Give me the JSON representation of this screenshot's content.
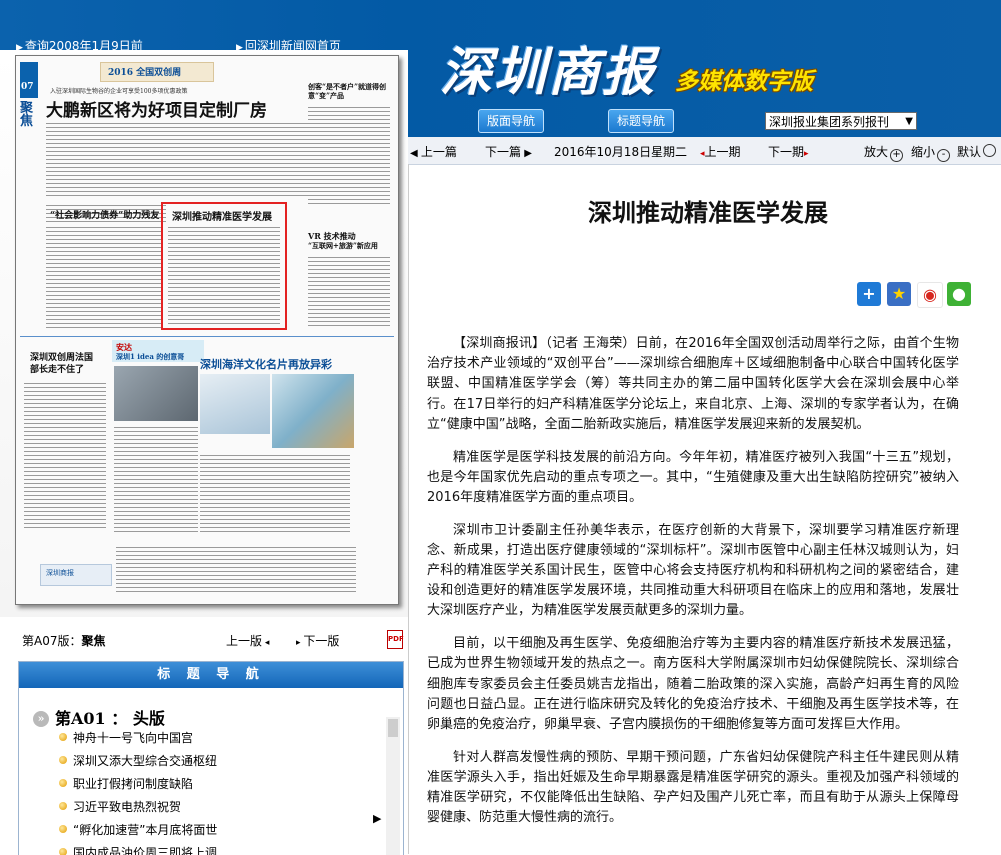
{
  "header": {
    "history_link": "查询2008年1月9日前",
    "home_link": "回深圳新闻网首页",
    "logo_text": "深圳商报",
    "logo_subtitle": "多媒体数字版",
    "nav_buttons": [
      "版面导航",
      "标题导航"
    ],
    "series_select": "深圳报业集团系列报刊"
  },
  "newspaper_page": {
    "page_number": "07",
    "section": "聚焦",
    "banner": "2016 全国双创周",
    "kicker": "入驻深圳国际生物谷的企业可享受100多项优惠政策",
    "main_headline": "大鹏新区将为好项目定制厂房",
    "side_headline": "“社会影响力债券”助力残友",
    "highlighted_headline": "深圳推动精准医学发展",
    "top_right_headline": "创客“是不者户”就道得创意“变”产品",
    "mid_right_headline_1": "VR 技术推动",
    "mid_right_headline_2": "“互联网+旅游”新应用",
    "bottom_left_headline": "深圳双创周法国部长走不住了",
    "bottom_mid_badge": "安达",
    "bottom_mid_headline": "深圳1 idea 的创意哥",
    "bottom_right_headline": "深圳海洋文化名片再放异彩",
    "footer_tag": "深圳商报"
  },
  "page_info": {
    "label": "第A07版：",
    "name": "聚焦",
    "prev_page": "上一版",
    "next_page": "下一版",
    "pdf_icon": "pdf-icon"
  },
  "title_nav": {
    "header": "标 题 导 航",
    "section": "第A01 ： 头版",
    "items": [
      "神舟十一号飞向中国宫",
      "深圳又添大型综合交通枢纽",
      "职业打假拷问制度缺陷",
      "习近平致电热烈祝贺",
      "“孵化加速营”本月底将面世",
      "国内成品油价周三即将上调"
    ]
  },
  "toolbar": {
    "prev_article": "上一篇",
    "next_article": "下一篇",
    "date": "2016年10月18日",
    "weekday": "星期二",
    "prev_issue": "上一期",
    "next_issue": "下一期",
    "zoom_in": "放大",
    "zoom_out": "缩小",
    "default": "默认"
  },
  "article": {
    "title": "深圳推动精准医学发展",
    "share_icons": [
      "plus-share-icon",
      "qzone-star-icon",
      "weibo-icon",
      "wechat-icon"
    ],
    "paragraphs": [
      "【深圳商报讯】（记者 王海荣）日前，在2016年全国双创活动周举行之际，由首个生物治疗技术产业领域的“双创平台”——深圳综合细胞库＋区域细胞制备中心联合中国转化医学联盟、中国精准医学学会（筹）等共同主办的第二届中国转化医学大会在深圳会展中心举行。在17日举行的妇产科精准医学分论坛上，来自北京、上海、深圳的专家学者认为，在确立“健康中国”战略，全面二胎新政实施后，精准医学发展迎来新的发展契机。",
      "精准医学是医学科技发展的前沿方向。今年年初，精准医疗被列入我国“十三五”规划，也是今年国家优先启动的重点专项之一。其中，“生殖健康及重大出生缺陷防控研究”被纳入2016年度精准医学方面的重点项目。",
      "深圳市卫计委副主任孙美华表示，在医疗创新的大背景下，深圳要学习精准医疗新理念、新成果，打造出医疗健康领域的“深圳标杆”。深圳市医管中心副主任林汉城则认为，妇产科的精准医学关系国计民生，医管中心将会支持医疗机构和科研机构之间的紧密结合，建设和创造更好的精准医学发展环境，共同推动重大科研项目在临床上的应用和落地，发展壮大深圳医疗产业，为精准医学发展贡献更多的深圳力量。",
      "目前，以干细胞及再生医学、免疫细胞治疗等为主要内容的精准医疗新技术发展迅猛，已成为世界生物领域开发的热点之一。南方医科大学附属深圳市妇幼保健院院长、深圳综合细胞库专家委员会主任委员姚吉龙指出，随着二胎政策的深入实施，高龄产妇再生育的风险问题也日益凸显。正在进行临床研究及转化的免疫治疗技术、干细胞及再生医学技术等，在卵巢癌的免疫治疗，卵巢早衰、子宫内膜损伤的干细胞修复等方面可发挥巨大作用。",
      "针对人群高发慢性病的预防、早期干预问题，广东省妇幼保健院产科主任牛建民则从精准医学源头入手，指出妊娠及生命早期暴露是精准医学研究的源头。重视及加强产科领域的精准医学研究，不仅能降低出生缺陷、孕产妇及围产儿死亡率，而且有助于从源头上保障母婴健康、防范重大慢性病的流行。"
    ]
  },
  "colors": {
    "header_blue": "#035aa5",
    "logo_yellow": "#ffe400",
    "highlight_red": "#e32222"
  }
}
